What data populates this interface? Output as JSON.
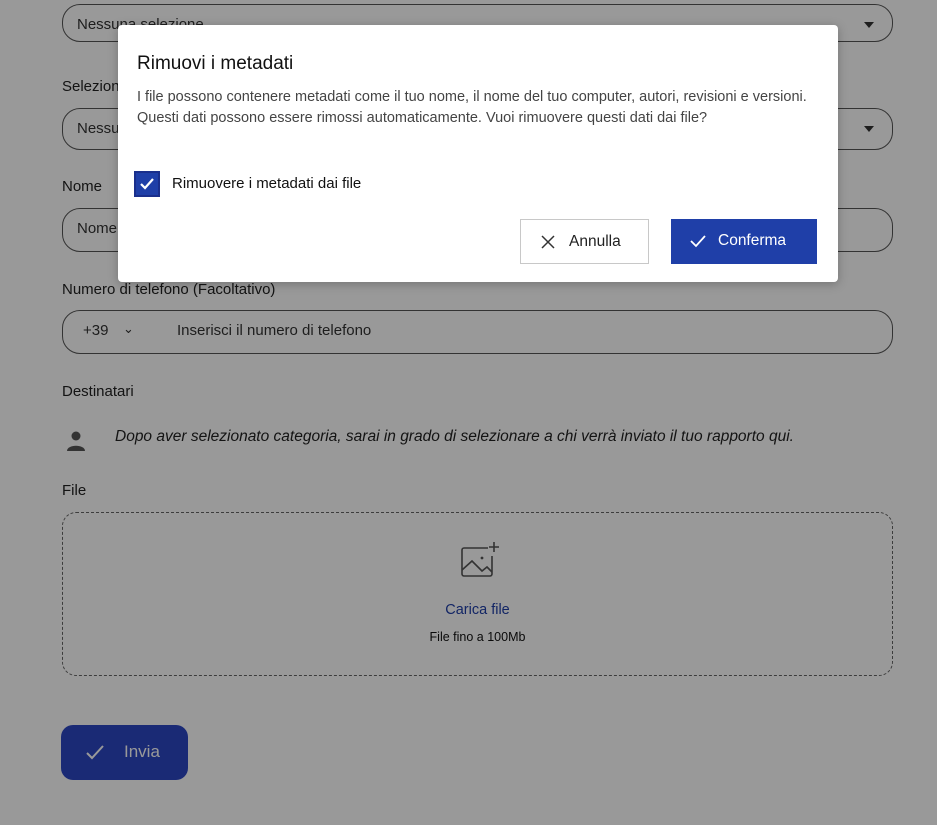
{
  "form": {
    "select1_placeholder": "Nessuna selezione",
    "select2_label": "Seleziona",
    "select2_placeholder": "Nessuna selezione",
    "name_label": "Nome",
    "name_placeholder": "Nome",
    "phone_label": "Numero di telefono (Facoltativo)",
    "phone_country_code": "+39",
    "phone_placeholder": "Inserisci il numero di telefono",
    "recipients_label": "Destinatari",
    "recipients_hint": "Dopo aver selezionato categoria, sarai in grado di selezionare a chi verrà inviato il tuo rapporto qui.",
    "file_label": "File",
    "upload_link": "Carica file",
    "upload_limit": "File fino a 100Mb",
    "submit_label": "Invia"
  },
  "modal": {
    "title": "Rimuovi i metadati",
    "body": "I file possono contenere metadati come il tuo nome, il nome del tuo computer, autori, revisioni e versioni. Questi dati possono essere rimossi automaticamente. Vuoi rimuovere questi dati dai file?",
    "checkbox_label": "Rimuovere i metadati dai file",
    "checkbox_checked": true,
    "cancel_label": "Annulla",
    "confirm_label": "Conferma"
  },
  "colors": {
    "primary": "#1f3fa8",
    "overlay": "rgba(0,0,0,0.40)"
  }
}
